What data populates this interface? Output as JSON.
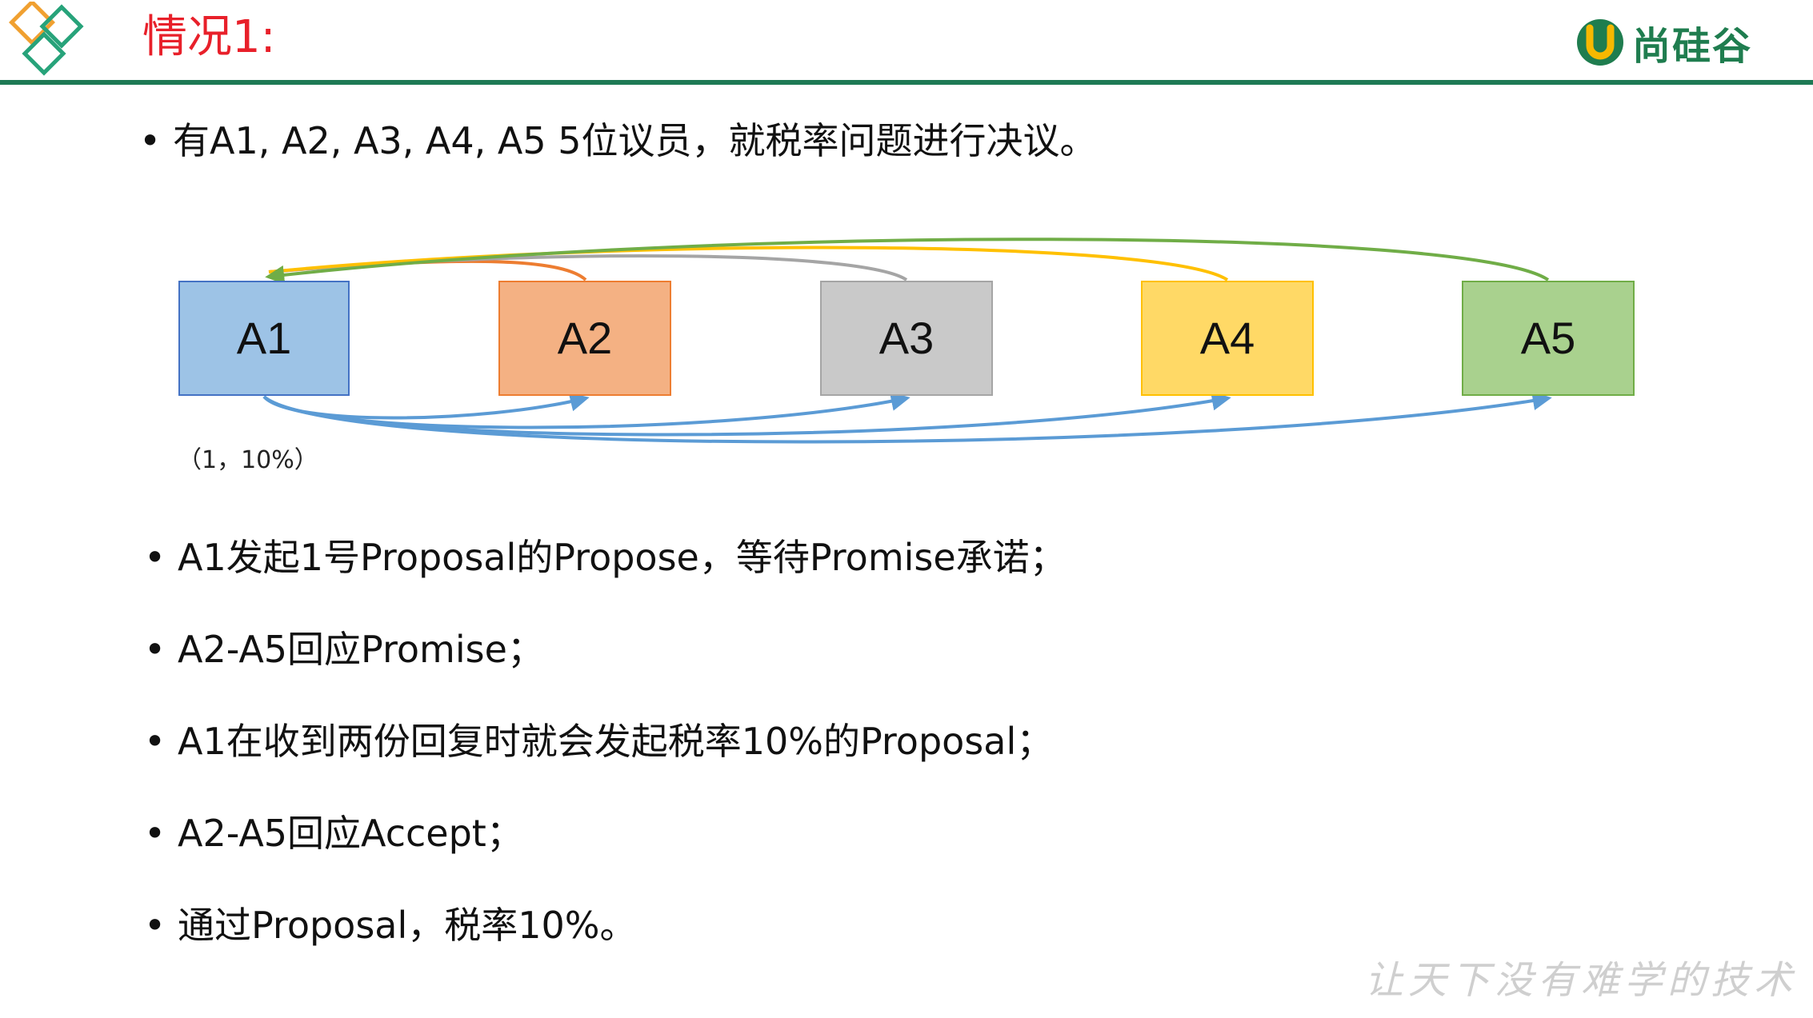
{
  "header": {
    "title": "情况1:",
    "brand": "尚硅谷",
    "brand_mark": "U"
  },
  "bullets": [
    "有A1, A2, A3, A4, A5 5位议员，就税率问题进行决议。",
    "A1发起1号Proposal的Propose，等待Promise承诺；",
    "A2-A5回应Promise；",
    "A1在收到两份回复时就会发起税率10%的Proposal；",
    "A2-A5回应Accept；",
    "通过Proposal，税率10%。"
  ],
  "bullet_symbol": "•",
  "diagram": {
    "nodes": [
      {
        "id": "A1",
        "label": "A1",
        "fill": "#9dc3e6",
        "stroke": "#4472c4"
      },
      {
        "id": "A2",
        "label": "A2",
        "fill": "#f4b183",
        "stroke": "#ed7d31"
      },
      {
        "id": "A3",
        "label": "A3",
        "fill": "#c9c9c9",
        "stroke": "#a5a5a5"
      },
      {
        "id": "A4",
        "label": "A4",
        "fill": "#ffd966",
        "stroke": "#ffc000"
      },
      {
        "id": "A5",
        "label": "A5",
        "fill": "#a9d18e",
        "stroke": "#70ad47"
      }
    ],
    "edges_to_a1": [
      {
        "from": "A2",
        "color": "#ed7d31"
      },
      {
        "from": "A3",
        "color": "#a5a5a5"
      },
      {
        "from": "A4",
        "color": "#ffc000"
      },
      {
        "from": "A5",
        "color": "#70ad47"
      }
    ],
    "edges_from_a1": [
      {
        "to": "A2",
        "color": "#5b9bd5"
      },
      {
        "to": "A3",
        "color": "#5b9bd5"
      },
      {
        "to": "A4",
        "color": "#5b9bd5"
      },
      {
        "to": "A5",
        "color": "#5b9bd5"
      }
    ],
    "annotation": "（1，10%）"
  },
  "watermark": "让天下没有难学的技术"
}
